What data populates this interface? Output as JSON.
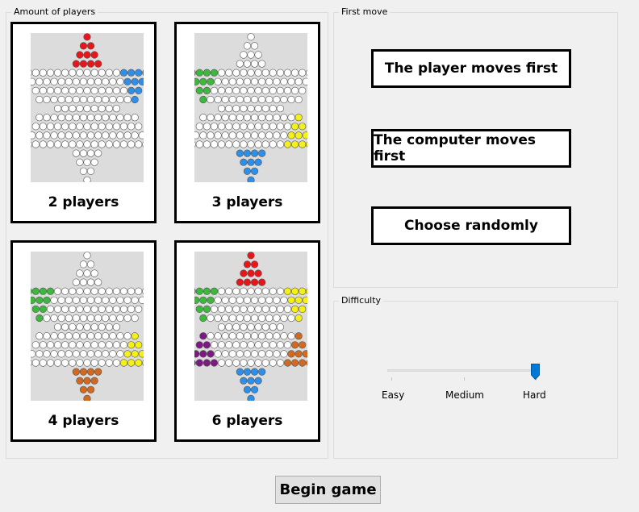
{
  "players_group": {
    "title": "Amount of players",
    "options": [
      {
        "label": "2 players",
        "colors": [
          "red",
          "blue"
        ]
      },
      {
        "label": "3 players",
        "colors": [
          "white",
          "white",
          "yellow",
          "blue",
          "white",
          "green"
        ]
      },
      {
        "label": "4 players",
        "colors": [
          "white",
          "white",
          "yellow",
          "orange",
          "white",
          "green",
          "blue"
        ]
      },
      {
        "label": "6 players",
        "colors": [
          "red",
          "yellow",
          "orange",
          "blue",
          "purple",
          "green"
        ]
      }
    ]
  },
  "first_move_group": {
    "title": "First move",
    "buttons": [
      "The player moves first",
      "The computer moves first",
      "Choose randomly"
    ]
  },
  "difficulty_group": {
    "title": "Difficulty",
    "levels": [
      "Easy",
      "Medium",
      "Hard"
    ],
    "selected": "Hard"
  },
  "begin_button": "Begin game",
  "peg_colors": {
    "red": "#e8161b",
    "yellow": "#f5f015",
    "orange": "#d2691e",
    "blue": "#2f8fe8",
    "purple": "#7c1a82",
    "green": "#3cb83c",
    "white": "#ffffff"
  }
}
